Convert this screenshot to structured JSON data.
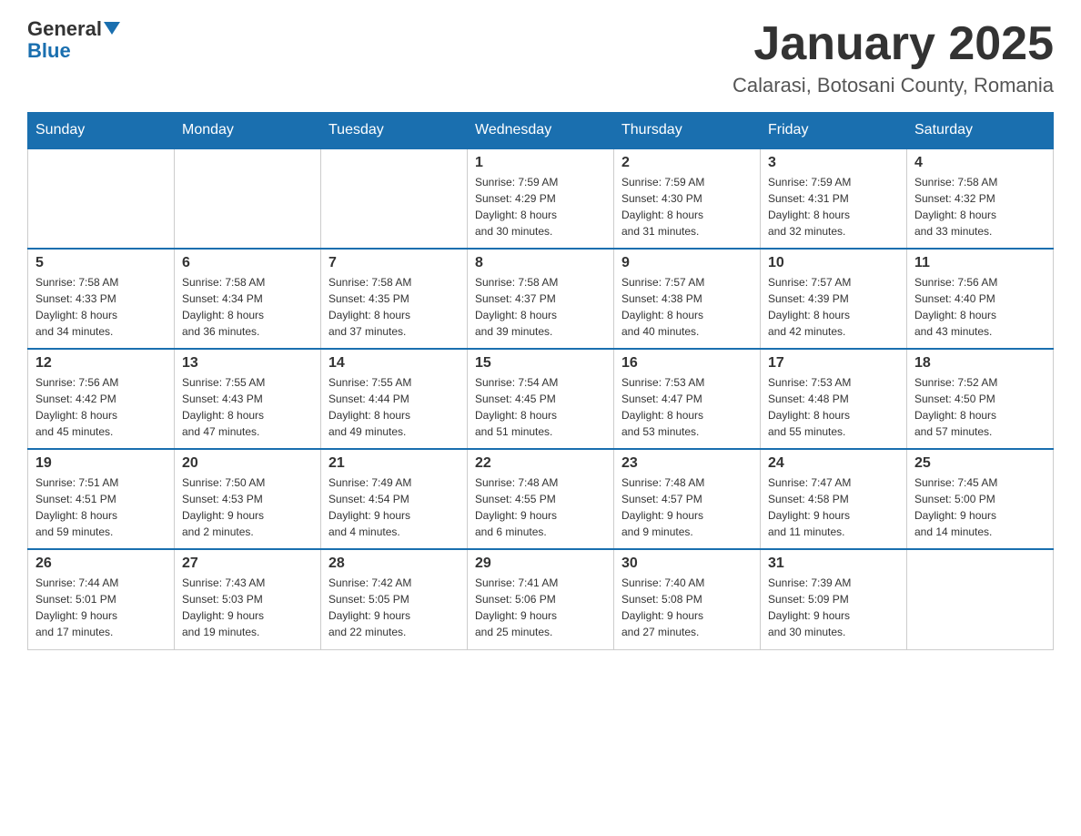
{
  "header": {
    "logo_general": "General",
    "logo_blue": "Blue",
    "month_title": "January 2025",
    "location": "Calarasi, Botosani County, Romania"
  },
  "days_of_week": [
    "Sunday",
    "Monday",
    "Tuesday",
    "Wednesday",
    "Thursday",
    "Friday",
    "Saturday"
  ],
  "weeks": [
    [
      {
        "day": "",
        "info": ""
      },
      {
        "day": "",
        "info": ""
      },
      {
        "day": "",
        "info": ""
      },
      {
        "day": "1",
        "info": "Sunrise: 7:59 AM\nSunset: 4:29 PM\nDaylight: 8 hours\nand 30 minutes."
      },
      {
        "day": "2",
        "info": "Sunrise: 7:59 AM\nSunset: 4:30 PM\nDaylight: 8 hours\nand 31 minutes."
      },
      {
        "day": "3",
        "info": "Sunrise: 7:59 AM\nSunset: 4:31 PM\nDaylight: 8 hours\nand 32 minutes."
      },
      {
        "day": "4",
        "info": "Sunrise: 7:58 AM\nSunset: 4:32 PM\nDaylight: 8 hours\nand 33 minutes."
      }
    ],
    [
      {
        "day": "5",
        "info": "Sunrise: 7:58 AM\nSunset: 4:33 PM\nDaylight: 8 hours\nand 34 minutes."
      },
      {
        "day": "6",
        "info": "Sunrise: 7:58 AM\nSunset: 4:34 PM\nDaylight: 8 hours\nand 36 minutes."
      },
      {
        "day": "7",
        "info": "Sunrise: 7:58 AM\nSunset: 4:35 PM\nDaylight: 8 hours\nand 37 minutes."
      },
      {
        "day": "8",
        "info": "Sunrise: 7:58 AM\nSunset: 4:37 PM\nDaylight: 8 hours\nand 39 minutes."
      },
      {
        "day": "9",
        "info": "Sunrise: 7:57 AM\nSunset: 4:38 PM\nDaylight: 8 hours\nand 40 minutes."
      },
      {
        "day": "10",
        "info": "Sunrise: 7:57 AM\nSunset: 4:39 PM\nDaylight: 8 hours\nand 42 minutes."
      },
      {
        "day": "11",
        "info": "Sunrise: 7:56 AM\nSunset: 4:40 PM\nDaylight: 8 hours\nand 43 minutes."
      }
    ],
    [
      {
        "day": "12",
        "info": "Sunrise: 7:56 AM\nSunset: 4:42 PM\nDaylight: 8 hours\nand 45 minutes."
      },
      {
        "day": "13",
        "info": "Sunrise: 7:55 AM\nSunset: 4:43 PM\nDaylight: 8 hours\nand 47 minutes."
      },
      {
        "day": "14",
        "info": "Sunrise: 7:55 AM\nSunset: 4:44 PM\nDaylight: 8 hours\nand 49 minutes."
      },
      {
        "day": "15",
        "info": "Sunrise: 7:54 AM\nSunset: 4:45 PM\nDaylight: 8 hours\nand 51 minutes."
      },
      {
        "day": "16",
        "info": "Sunrise: 7:53 AM\nSunset: 4:47 PM\nDaylight: 8 hours\nand 53 minutes."
      },
      {
        "day": "17",
        "info": "Sunrise: 7:53 AM\nSunset: 4:48 PM\nDaylight: 8 hours\nand 55 minutes."
      },
      {
        "day": "18",
        "info": "Sunrise: 7:52 AM\nSunset: 4:50 PM\nDaylight: 8 hours\nand 57 minutes."
      }
    ],
    [
      {
        "day": "19",
        "info": "Sunrise: 7:51 AM\nSunset: 4:51 PM\nDaylight: 8 hours\nand 59 minutes."
      },
      {
        "day": "20",
        "info": "Sunrise: 7:50 AM\nSunset: 4:53 PM\nDaylight: 9 hours\nand 2 minutes."
      },
      {
        "day": "21",
        "info": "Sunrise: 7:49 AM\nSunset: 4:54 PM\nDaylight: 9 hours\nand 4 minutes."
      },
      {
        "day": "22",
        "info": "Sunrise: 7:48 AM\nSunset: 4:55 PM\nDaylight: 9 hours\nand 6 minutes."
      },
      {
        "day": "23",
        "info": "Sunrise: 7:48 AM\nSunset: 4:57 PM\nDaylight: 9 hours\nand 9 minutes."
      },
      {
        "day": "24",
        "info": "Sunrise: 7:47 AM\nSunset: 4:58 PM\nDaylight: 9 hours\nand 11 minutes."
      },
      {
        "day": "25",
        "info": "Sunrise: 7:45 AM\nSunset: 5:00 PM\nDaylight: 9 hours\nand 14 minutes."
      }
    ],
    [
      {
        "day": "26",
        "info": "Sunrise: 7:44 AM\nSunset: 5:01 PM\nDaylight: 9 hours\nand 17 minutes."
      },
      {
        "day": "27",
        "info": "Sunrise: 7:43 AM\nSunset: 5:03 PM\nDaylight: 9 hours\nand 19 minutes."
      },
      {
        "day": "28",
        "info": "Sunrise: 7:42 AM\nSunset: 5:05 PM\nDaylight: 9 hours\nand 22 minutes."
      },
      {
        "day": "29",
        "info": "Sunrise: 7:41 AM\nSunset: 5:06 PM\nDaylight: 9 hours\nand 25 minutes."
      },
      {
        "day": "30",
        "info": "Sunrise: 7:40 AM\nSunset: 5:08 PM\nDaylight: 9 hours\nand 27 minutes."
      },
      {
        "day": "31",
        "info": "Sunrise: 7:39 AM\nSunset: 5:09 PM\nDaylight: 9 hours\nand 30 minutes."
      },
      {
        "day": "",
        "info": ""
      }
    ]
  ]
}
